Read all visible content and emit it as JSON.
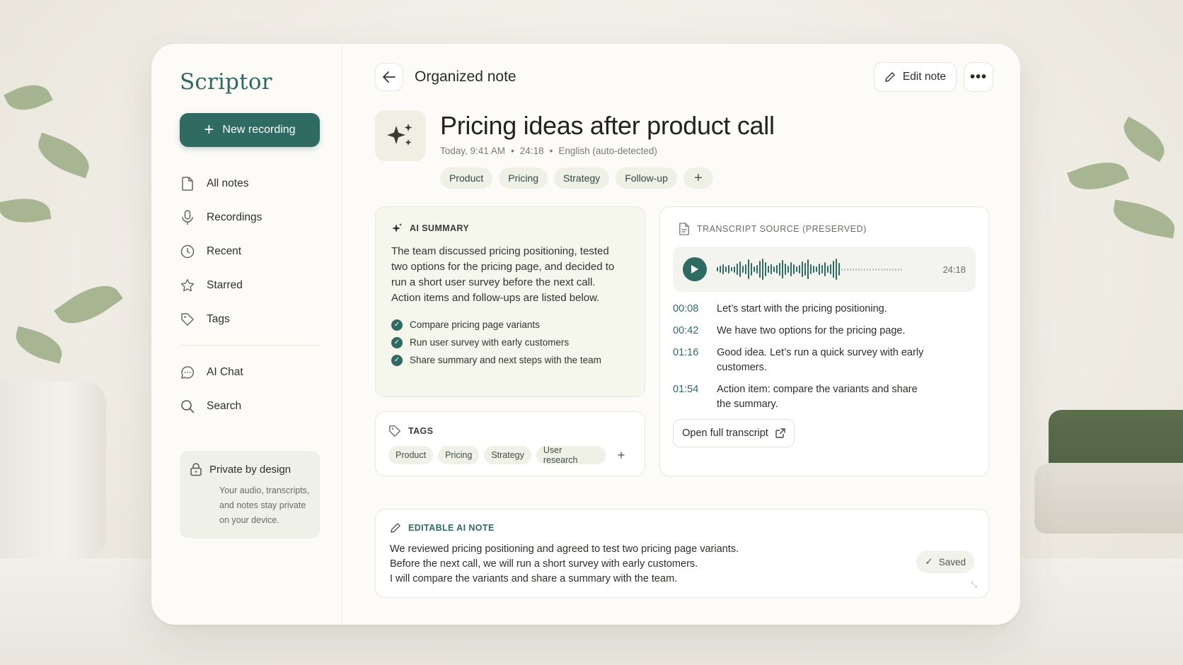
{
  "app": {
    "brand": "Scriptor",
    "accent": "#2f6b63"
  },
  "sidebar": {
    "new_recording": "New recording",
    "items": [
      {
        "label": "All notes",
        "icon": "document-icon"
      },
      {
        "label": "Recordings",
        "icon": "microphone-icon"
      },
      {
        "label": "Recent",
        "icon": "clock-icon"
      },
      {
        "label": "Starred",
        "icon": "star-icon"
      },
      {
        "label": "Tags",
        "icon": "tag-icon"
      }
    ],
    "secondary": [
      {
        "label": "AI Chat",
        "icon": "chat-icon"
      },
      {
        "label": "Search",
        "icon": "search-icon"
      }
    ],
    "private": {
      "title": "Private by design",
      "text": "Your audio, transcripts, and notes stay private on your device."
    }
  },
  "header": {
    "title": "Organized note",
    "edit_label": "Edit note"
  },
  "note": {
    "title": "Pricing ideas after product call",
    "date": "Today, 9:41 AM",
    "duration": "24:18",
    "language": "English (auto-detected)",
    "chips": [
      "Product",
      "Pricing",
      "Strategy",
      "Follow-up"
    ]
  },
  "summary": {
    "heading": "AI SUMMARY",
    "text": "The team discussed pricing positioning, tested two options for the pricing page, and decided to run a short user survey before the next call. Action items and follow-ups are listed below.",
    "items": [
      "Compare pricing page variants",
      "Run user survey with early customers",
      "Share summary and next steps with the team"
    ]
  },
  "tags": {
    "heading": "TAGS",
    "items": [
      "Product",
      "Pricing",
      "Strategy",
      "User research"
    ]
  },
  "transcript": {
    "heading": "TRANSCRIPT SOURCE (PRESERVED)",
    "duration": "24:18",
    "lines": [
      {
        "time": "00:08",
        "text": "Let’s start with the pricing positioning."
      },
      {
        "time": "00:42",
        "text": "We have two options for the pricing page."
      },
      {
        "time": "01:16",
        "text": "Good idea. Let’s run a quick survey with early customers."
      },
      {
        "time": "01:54",
        "text": "Action item: compare the variants and share the summary."
      }
    ],
    "open_label": "Open full transcript"
  },
  "editable": {
    "heading": "EDITABLE AI NOTE",
    "lines": [
      "We reviewed pricing positioning and agreed to test two pricing page variants.",
      "Before the next call, we will run a short survey with early customers.",
      "I will compare the variants and share a summary with the team."
    ],
    "status": "Saved"
  }
}
